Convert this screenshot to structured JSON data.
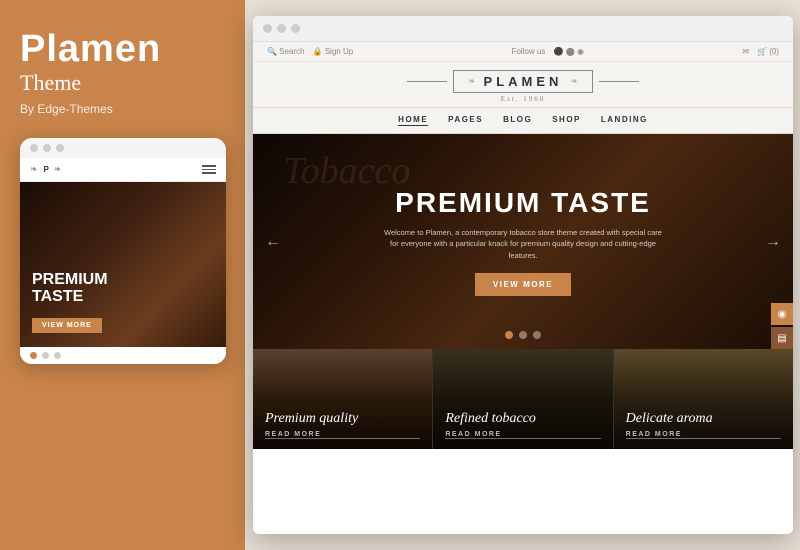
{
  "left": {
    "brand_title": "Plamen",
    "brand_subtitle": "Theme",
    "brand_by": "By Edge-Themes",
    "mobile_preview": {
      "dots": [
        "",
        "",
        ""
      ],
      "logo_deco": "❧—P—❧",
      "hero_title": "PREMIUM\nTASTE",
      "hero_btn": "VIEW MORE",
      "slide_dots": [
        "active",
        "",
        ""
      ]
    }
  },
  "right": {
    "browser": {
      "top_bar_left": "Search   Sign Up",
      "top_bar_center": "Follow us",
      "top_bar_right": "✉  🛒 (0)",
      "logo_text": "PLAMEN",
      "logo_est": "Est. 1960",
      "nav_items": [
        "HOME",
        "PAGES",
        "BLOG",
        "SHOP",
        "LANDING"
      ],
      "hero_overlay": "Tobacco",
      "hero_title": "PREMIUM TASTE",
      "hero_subtitle": "Welcome to Plamen, a contemporary tobacco store theme created with special care for everyone with a particular knack for premium quality design and cutting-edge features.",
      "hero_btn": "VIEW MORE",
      "hero_dots": [
        "active",
        "",
        ""
      ],
      "feature_cards": [
        {
          "title": "Premium quality",
          "link": "READ MORE"
        },
        {
          "title": "Refined tobacco",
          "link": "READ MORE"
        },
        {
          "title": "Delicate aroma",
          "link": "READ MORE"
        }
      ]
    }
  },
  "colors": {
    "brand": "#c8844a",
    "dark": "#1a0a04",
    "text_light": "#ffffff"
  }
}
